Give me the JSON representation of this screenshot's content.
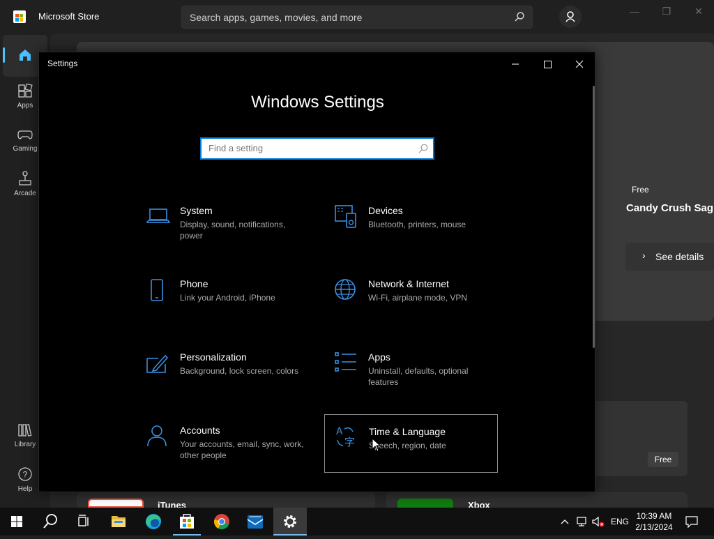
{
  "store": {
    "title": "Microsoft Store",
    "search_placeholder": "Search apps, games, movies, and more",
    "nav": [
      {
        "label": ""
      },
      {
        "label": "Apps"
      },
      {
        "label": "Gaming"
      },
      {
        "label": "Arcade"
      },
      {
        "label": "Library"
      },
      {
        "label": "Help"
      }
    ],
    "hero": {
      "price": "Free",
      "title": "Candy Crush Sag",
      "details_label": "See details"
    },
    "card_price": "Free",
    "bottom_cards": [
      {
        "name": "iTunes"
      },
      {
        "name": "Xbox"
      }
    ]
  },
  "settings": {
    "window_title": "Settings",
    "heading": "Windows Settings",
    "search_placeholder": "Find a setting",
    "tiles": [
      {
        "title": "System",
        "desc": "Display, sound, notifications, power",
        "icon": "laptop-icon"
      },
      {
        "title": "Devices",
        "desc": "Bluetooth, printers, mouse",
        "icon": "devices-icon"
      },
      {
        "title": "Phone",
        "desc": "Link your Android, iPhone",
        "icon": "phone-icon"
      },
      {
        "title": "Network & Internet",
        "desc": "Wi-Fi, airplane mode, VPN",
        "icon": "globe-icon"
      },
      {
        "title": "Personalization",
        "desc": "Background, lock screen, colors",
        "icon": "paint-icon"
      },
      {
        "title": "Apps",
        "desc": "Uninstall, defaults, optional features",
        "icon": "apps-list-icon"
      },
      {
        "title": "Accounts",
        "desc": "Your accounts, email, sync, work, other people",
        "icon": "person-icon"
      },
      {
        "title": "Time & Language",
        "desc": "Speech, region, date",
        "icon": "time-language-icon"
      }
    ]
  },
  "taskbar": {
    "apps": [
      "start",
      "search",
      "task-view",
      "file-explorer",
      "edge",
      "microsoft-store",
      "chrome",
      "mail",
      "settings"
    ],
    "language": "ENG",
    "time": "10:39 AM",
    "date": "2/13/2024"
  },
  "colors": {
    "accent": "#0078d7",
    "icon_blue": "#3a8fe0",
    "settings_bg": "#000000",
    "store_bg": "#202020"
  }
}
